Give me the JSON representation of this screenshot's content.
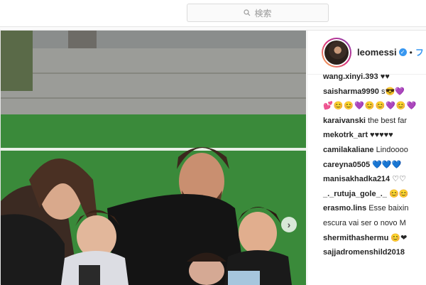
{
  "search": {
    "placeholder": "検索"
  },
  "post": {
    "username": "leomessi",
    "follow_label": "フ",
    "comments": [
      {
        "user": "wang.xinyi.393",
        "text": "♥♥"
      },
      {
        "user": "saisharma9990",
        "text": "s😎💜"
      },
      {
        "user": "",
        "text": "💕😊😊💜😊😊💜😊💜"
      },
      {
        "user": "karaivanski",
        "text": "the best far"
      },
      {
        "user": "mekotrk_art",
        "text": "♥♥♥♥♥"
      },
      {
        "user": "camilakaliane",
        "text": "Lindoooo"
      },
      {
        "user": "careyna0505",
        "text": "💙💙💙"
      },
      {
        "user": "manisakhadka214",
        "text": "♡♡"
      },
      {
        "user": "_._rutuja_gole_._",
        "text": "😊😊"
      },
      {
        "user": "erasmo.lins",
        "text": "Esse baixin"
      },
      {
        "user": "",
        "text": "escura vai ser o novo M"
      },
      {
        "user": "shermithashermu",
        "text": "😊❤"
      },
      {
        "user": "sajjadromenshild2018",
        "text": ""
      }
    ]
  },
  "icons": {
    "search": "search-icon",
    "verified": "verified-badge-icon",
    "next": "chevron-right-icon"
  },
  "colors": {
    "accent": "#3897f0",
    "grass": "#3a8a3a"
  }
}
